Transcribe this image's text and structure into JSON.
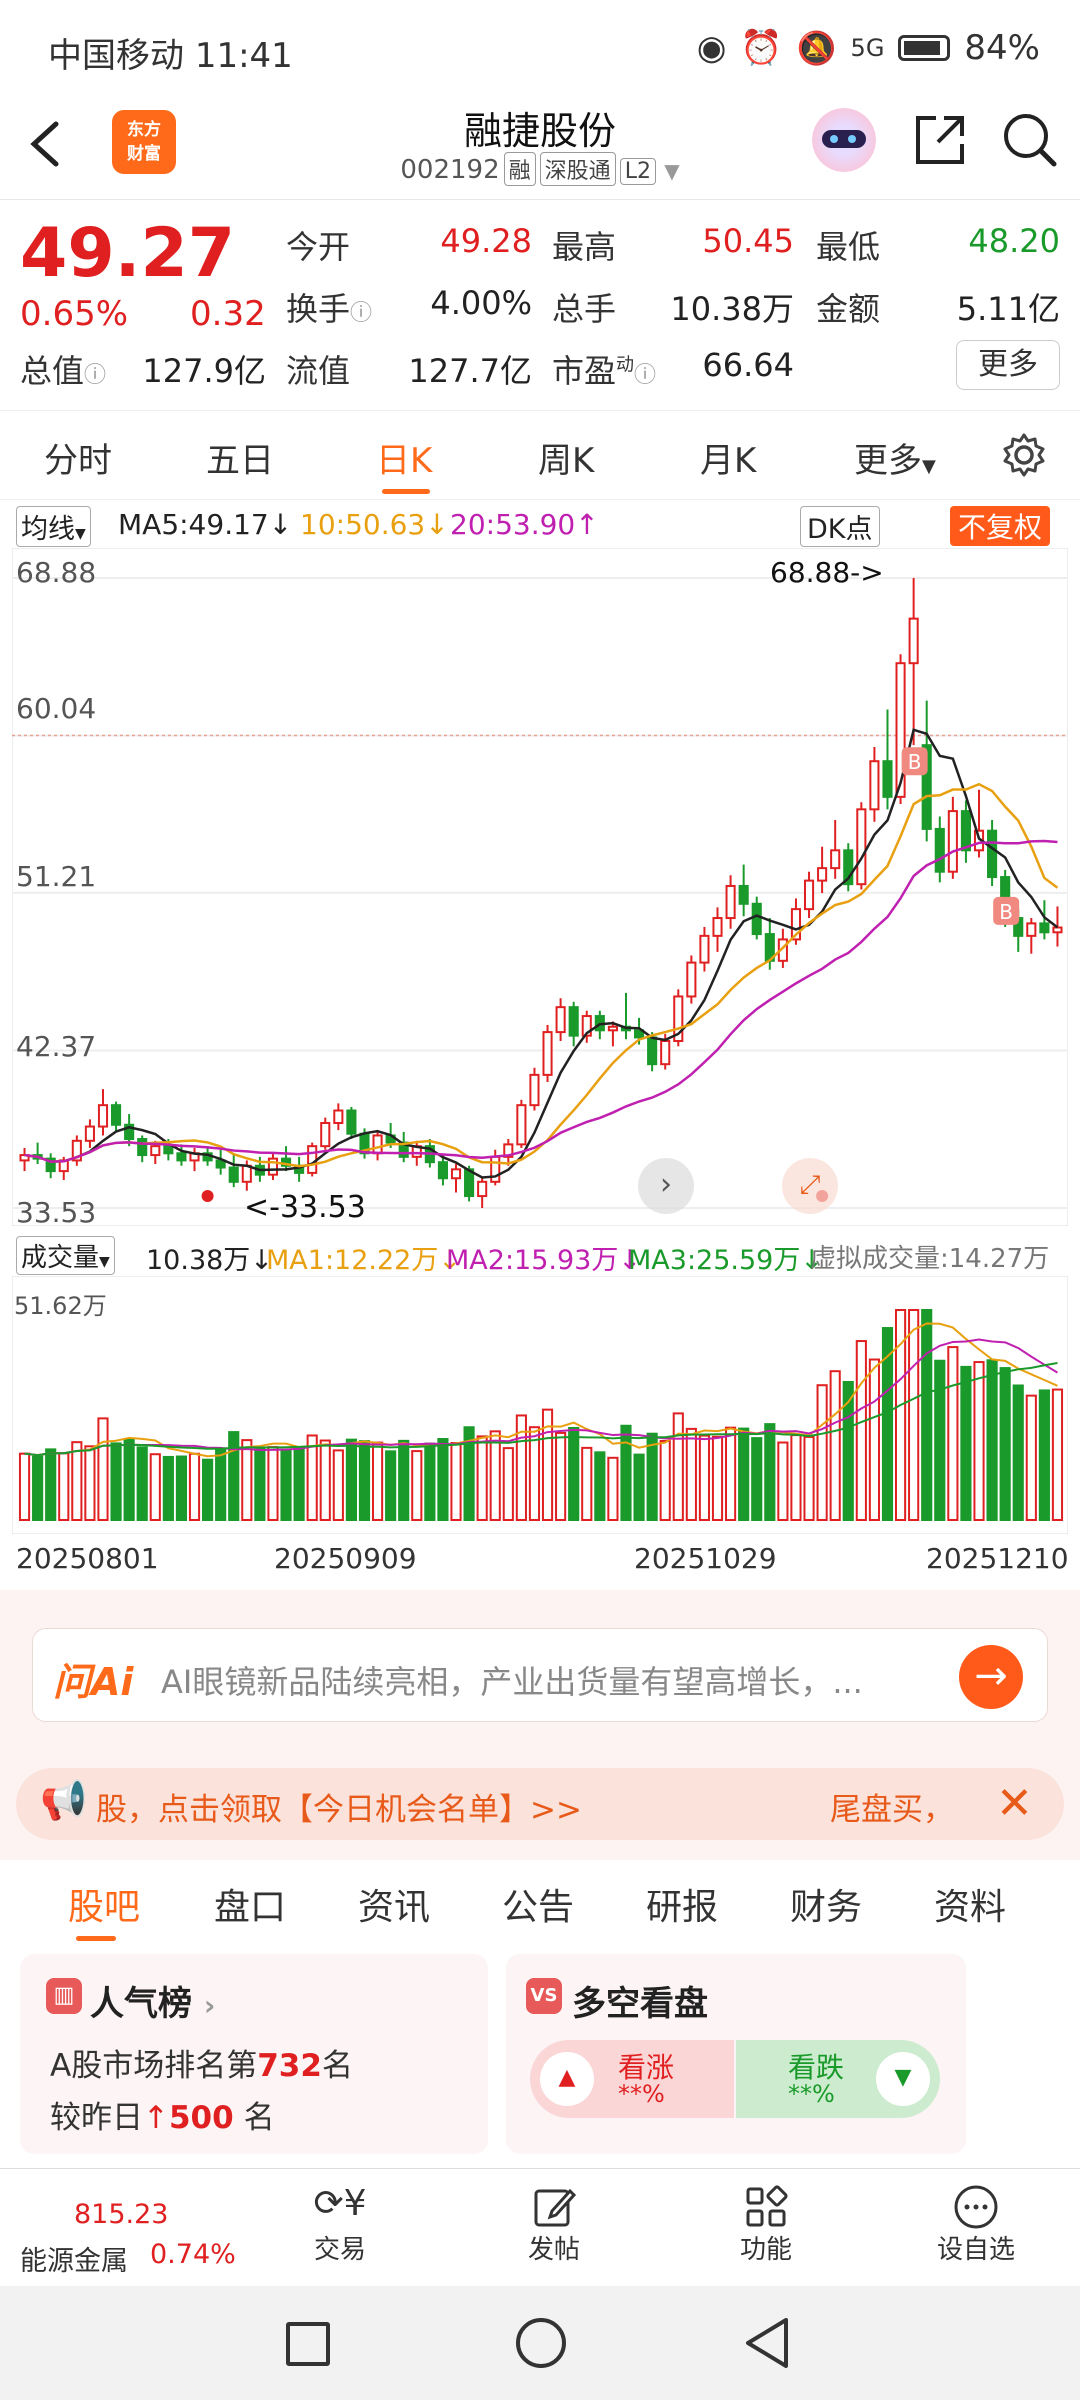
{
  "status": {
    "carrier": "中国移动",
    "time": "11:41",
    "battery": "84%",
    "network": "5G"
  },
  "header": {
    "logo_line1": "东方",
    "logo_line2": "财富",
    "title": "融捷股份",
    "code": "002192",
    "tags": [
      "融",
      "深股通",
      "L2"
    ]
  },
  "quote": {
    "price": "49.27",
    "pct": "0.65%",
    "chg": "0.32",
    "open_label": "今开",
    "open": "49.28",
    "high_label": "最高",
    "high": "50.45",
    "low_label": "最低",
    "low": "48.20",
    "turnover_label": "换手",
    "turnover": "4.00%",
    "vol_label": "总手",
    "vol": "10.38万",
    "amount_label": "金额",
    "amount": "5.11亿",
    "mcap_label": "总值",
    "mcap": "127.9亿",
    "float_label": "流值",
    "float": "127.7亿",
    "pe_label": "市盈",
    "pe_sup": "动",
    "pe": "66.64",
    "more": "更多"
  },
  "tabs": [
    "分时",
    "五日",
    "日K",
    "周K",
    "月K",
    "更多"
  ],
  "ma_line": {
    "selector": "均线",
    "ma5": "MA5:49.17↓",
    "ma10": "10:50.63↓",
    "ma20": "20:53.90↑",
    "dk": "DK点",
    "fq": "不复权"
  },
  "kchart": {
    "y_labels": [
      "68.88",
      "60.04",
      "51.21",
      "42.37",
      "33.53"
    ],
    "max_label": "68.88->",
    "min_label": "<-33.53"
  },
  "vol": {
    "selector": "成交量",
    "v": "10.38万↓",
    "ma1": "MA1:12.22万↓",
    "ma2": "MA2:15.93万↓",
    "ma3": "MA3:25.59万↓",
    "virtual": "虚拟成交量:14.27万",
    "max": "51.62万"
  },
  "dates": [
    "20250801",
    "20250909",
    "20251029",
    "20251210"
  ],
  "ai": {
    "logo": "问Ai",
    "text": "AI眼镜新品陆续亮相，产业出货量有望高增长，..."
  },
  "banner": {
    "text": "股，点击领取【今日机会名单】>>",
    "right": "尾盘买，"
  },
  "subtabs": [
    "股吧",
    "盘口",
    "资讯",
    "公告",
    "研报",
    "财务",
    "资料"
  ],
  "popularity": {
    "title": "人气榜",
    "line1_pre": "A股市场排名第",
    "rank": "732",
    "line1_post": "名",
    "line2_pre": "较昨日",
    "change": "500",
    "line2_post": "名"
  },
  "sentiment": {
    "title": "多空看盘",
    "up": "看涨",
    "up_v": "**%",
    "down": "看跌",
    "down_v": "**%"
  },
  "bottom": {
    "sector": "能源金属",
    "sector_value": "815.23",
    "sector_pct": "0.74%",
    "items": [
      "交易",
      "发帖",
      "功能",
      "设自选"
    ]
  },
  "chart_data": {
    "type": "candlestick",
    "y_range": [
      33.53,
      68.88
    ],
    "ohlc": [
      [
        36.2,
        36.9,
        35.6,
        36.5
      ],
      [
        36.5,
        37.2,
        36.0,
        36.3
      ],
      [
        36.3,
        36.6,
        35.2,
        35.6
      ],
      [
        35.6,
        36.4,
        35.1,
        36.2
      ],
      [
        36.2,
        37.6,
        35.9,
        37.3
      ],
      [
        37.3,
        38.5,
        36.9,
        38.1
      ],
      [
        38.1,
        40.2,
        37.6,
        39.3
      ],
      [
        39.3,
        39.5,
        37.8,
        38.2
      ],
      [
        38.2,
        38.8,
        37.0,
        37.4
      ],
      [
        37.4,
        37.6,
        36.1,
        36.5
      ],
      [
        36.5,
        37.3,
        36.0,
        37.0
      ],
      [
        37.0,
        37.4,
        36.2,
        36.6
      ],
      [
        36.6,
        37.1,
        35.9,
        36.2
      ],
      [
        36.2,
        36.9,
        35.6,
        36.6
      ],
      [
        36.6,
        37.0,
        35.9,
        36.2
      ],
      [
        36.2,
        36.8,
        35.4,
        35.8
      ],
      [
        35.8,
        36.6,
        34.7,
        35.0
      ],
      [
        35.0,
        36.2,
        34.5,
        35.9
      ],
      [
        35.9,
        36.4,
        35.0,
        35.4
      ],
      [
        35.4,
        36.6,
        35.1,
        36.3
      ],
      [
        36.3,
        37.0,
        35.6,
        35.9
      ],
      [
        35.9,
        36.4,
        35.0,
        35.5
      ],
      [
        35.5,
        37.2,
        35.3,
        37.0
      ],
      [
        37.0,
        38.6,
        36.8,
        38.3
      ],
      [
        38.3,
        39.4,
        37.9,
        39.0
      ],
      [
        39.0,
        39.2,
        37.4,
        37.7
      ],
      [
        37.7,
        38.0,
        36.3,
        36.6
      ],
      [
        36.6,
        37.9,
        36.2,
        37.6
      ],
      [
        37.6,
        38.3,
        36.9,
        37.2
      ],
      [
        37.2,
        37.8,
        36.1,
        36.4
      ],
      [
        36.4,
        37.3,
        35.9,
        37.0
      ],
      [
        37.0,
        37.4,
        35.8,
        36.1
      ],
      [
        36.1,
        36.5,
        34.8,
        35.2
      ],
      [
        35.2,
        36.0,
        34.4,
        35.7
      ],
      [
        35.7,
        35.9,
        33.9,
        34.2
      ],
      [
        34.2,
        35.3,
        33.53,
        35.0
      ],
      [
        35.0,
        36.8,
        34.8,
        36.4
      ],
      [
        36.4,
        37.4,
        35.9,
        37.1
      ],
      [
        37.1,
        39.6,
        36.9,
        39.3
      ],
      [
        39.3,
        41.4,
        39.0,
        41.0
      ],
      [
        41.0,
        43.8,
        40.6,
        43.4
      ],
      [
        43.4,
        45.3,
        42.9,
        44.8
      ],
      [
        44.8,
        45.1,
        42.6,
        43.2
      ],
      [
        43.2,
        44.6,
        42.8,
        44.3
      ],
      [
        44.3,
        44.6,
        43.0,
        43.5
      ],
      [
        43.5,
        44.0,
        42.6,
        43.7
      ],
      [
        43.7,
        45.6,
        43.0,
        43.5
      ],
      [
        43.5,
        44.2,
        42.7,
        43.1
      ],
      [
        43.1,
        43.4,
        41.2,
        41.6
      ],
      [
        41.6,
        43.3,
        41.3,
        42.9
      ],
      [
        42.9,
        45.8,
        42.6,
        45.4
      ],
      [
        45.4,
        47.7,
        45.0,
        47.3
      ],
      [
        47.3,
        49.3,
        46.8,
        48.8
      ],
      [
        48.8,
        50.4,
        47.9,
        49.8
      ],
      [
        49.8,
        52.2,
        49.2,
        51.6
      ],
      [
        51.6,
        52.8,
        49.9,
        50.6
      ],
      [
        50.6,
        51.0,
        48.6,
        48.9
      ],
      [
        48.9,
        49.8,
        46.9,
        47.4
      ],
      [
        47.4,
        49.2,
        47.0,
        48.6
      ],
      [
        48.6,
        50.9,
        48.3,
        50.3
      ],
      [
        50.3,
        52.4,
        49.8,
        51.9
      ],
      [
        51.9,
        53.8,
        51.2,
        52.6
      ],
      [
        52.6,
        55.3,
        52.0,
        53.6
      ],
      [
        53.6,
        54.0,
        51.3,
        51.7
      ],
      [
        51.7,
        56.3,
        51.4,
        55.9
      ],
      [
        55.9,
        59.4,
        55.2,
        58.6
      ],
      [
        58.6,
        61.5,
        55.9,
        56.6
      ],
      [
        56.6,
        64.6,
        56.2,
        64.1
      ],
      [
        64.1,
        68.88,
        59.5,
        66.6
      ],
      [
        59.5,
        62.0,
        54.1,
        54.8
      ],
      [
        54.8,
        55.5,
        51.8,
        52.4
      ],
      [
        52.4,
        56.6,
        52.0,
        55.8
      ],
      [
        55.8,
        56.4,
        52.9,
        53.6
      ],
      [
        53.6,
        57.0,
        53.2,
        54.7
      ],
      [
        54.7,
        55.3,
        51.6,
        52.1
      ],
      [
        52.1,
        52.5,
        49.3,
        49.8
      ],
      [
        49.8,
        50.3,
        47.9,
        48.8
      ],
      [
        48.8,
        49.8,
        47.8,
        49.5
      ],
      [
        49.5,
        50.8,
        48.6,
        49.0
      ],
      [
        49.0,
        50.45,
        48.2,
        49.27
      ]
    ],
    "volume_wan_max": 51.62
  }
}
